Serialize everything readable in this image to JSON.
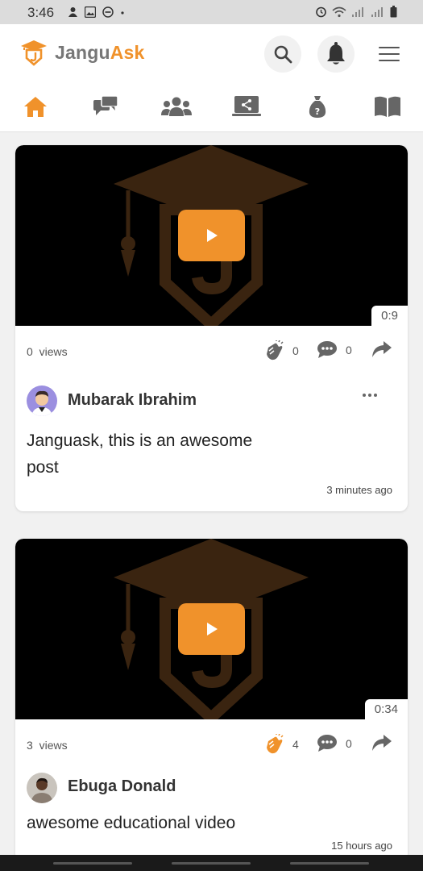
{
  "status_bar": {
    "time": "3:46"
  },
  "header": {
    "logo_text_part1": "Jangu",
    "logo_text_part2": "Ask",
    "icons": [
      "search-icon",
      "bell-icon",
      "menu-icon"
    ]
  },
  "nav": {
    "items": [
      "home-icon",
      "chat-icon",
      "groups-icon",
      "share-screen-icon",
      "question-bag-icon",
      "book-icon"
    ],
    "active": "home-icon"
  },
  "posts": [
    {
      "duration": "0:9",
      "views_count": "0",
      "views_label": "views",
      "claps": "0",
      "comments": "0",
      "author": "Mubarak Ibrahim",
      "text": "Janguask, this is an awesome post",
      "time": "3 minutes ago",
      "clapped": false
    },
    {
      "duration": "0:34",
      "views_count": "3",
      "views_label": "views",
      "claps": "4",
      "comments": "0",
      "author": "Ebuga Donald",
      "text": "awesome educational video",
      "time": "15 hours ago",
      "clapped": true
    }
  ],
  "colors": {
    "accent": "#f0922b",
    "icon_gray": "#666666",
    "poster_brown": "#3a2410"
  }
}
